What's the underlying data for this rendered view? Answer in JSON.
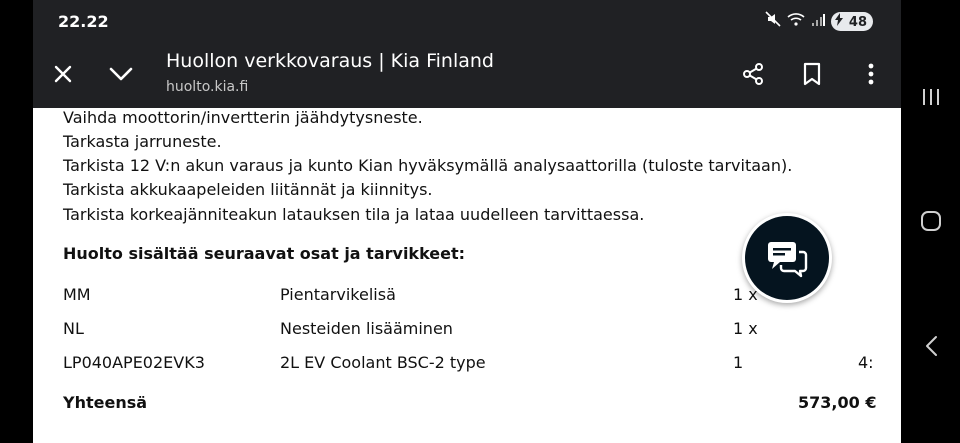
{
  "status": {
    "time": "22.22",
    "battery": "48"
  },
  "toolbar": {
    "title": "Huollon verkkovaraus | Kia Finland",
    "url": "huolto.kia.fi"
  },
  "content": {
    "tasks": [
      "Vaihda moottorin/invertterin jäähdytysneste.",
      "Tarkasta jarruneste.",
      "Tarkista 12 V:n akun varaus ja kunto Kian hyväksymällä analysaattorilla (tuloste tarvitaan).",
      "Tarkista akkukaapeleiden liitännät ja kiinnitys.",
      "Tarkista korkeajänniteakun latauksen tila ja lataa uudelleen tarvittaessa."
    ],
    "parts_heading": "Huolto sisältää seuraavat osat ja tarvikkeet:",
    "parts": [
      {
        "code": "MM",
        "name": "Pientarvikelisä",
        "qty": "1 x",
        "price": ""
      },
      {
        "code": "NL",
        "name": "Nesteiden lisääminen",
        "qty": "1 x",
        "price": ""
      },
      {
        "code": "LP040APE02EVK3",
        "name": "2L EV Coolant BSC-2 type",
        "qty": "1",
        "price": "4:"
      }
    ],
    "total_label": "Yhteensä",
    "total_value": "573,00 €"
  }
}
